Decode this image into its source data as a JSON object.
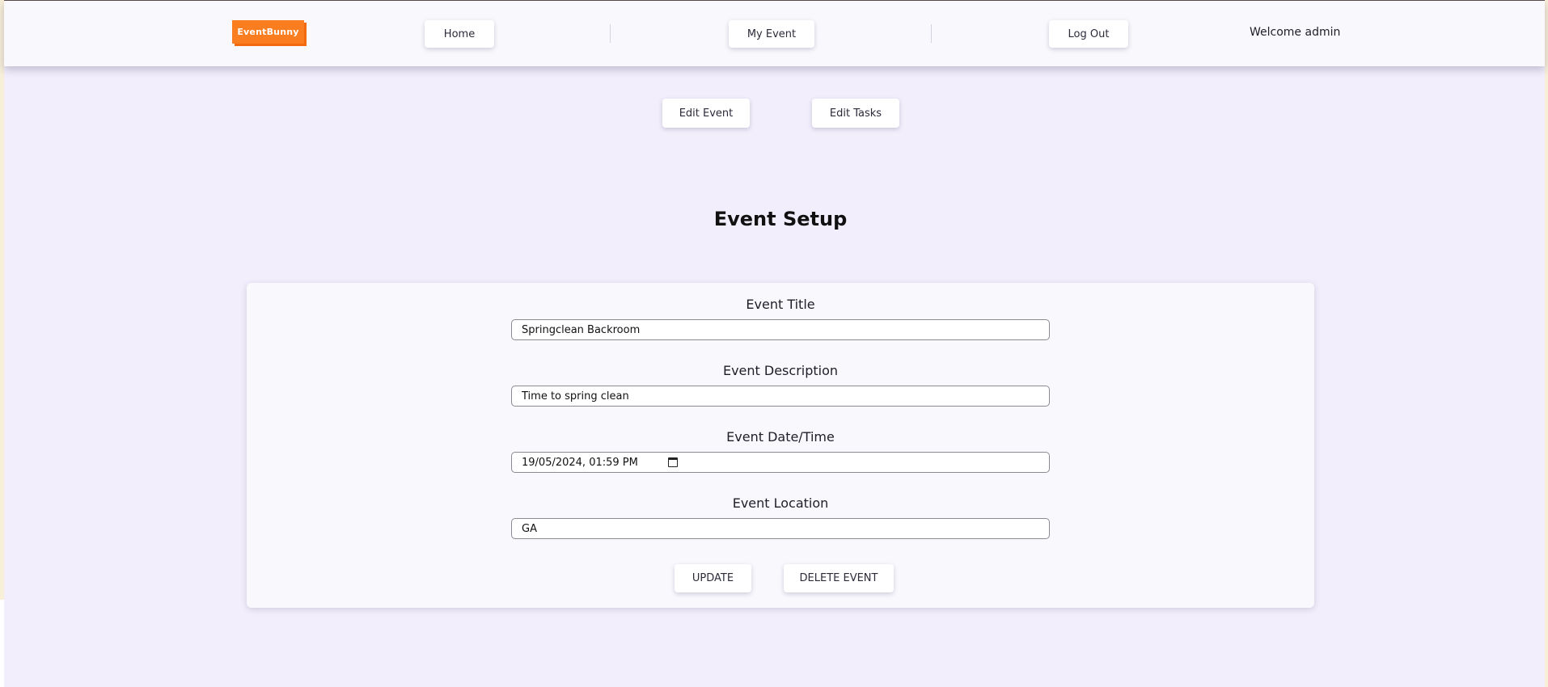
{
  "nav": {
    "logo": "EventBunny",
    "home_label": "Home",
    "my_event_label": "My Event",
    "logout_label": "Log Out",
    "welcome_text": "Welcome admin"
  },
  "subnav": {
    "edit_event_label": "Edit Event",
    "edit_tasks_label": "Edit Tasks"
  },
  "page_title": "Event Setup",
  "form": {
    "title_label": "Event Title",
    "title_value": "Springclean Backroom",
    "description_label": "Event Description",
    "description_value": "Time to spring clean",
    "datetime_label": "Event Date/Time",
    "datetime_value": "19/05/2024, 01:59 PM",
    "datetime_icon": "calendar-icon",
    "location_label": "Event Location",
    "location_value": "GA",
    "update_label": "UPDATE",
    "delete_label": "DELETE EVENT"
  },
  "colors": {
    "brand": "#fa7d1f",
    "page_background": "#f2eefc",
    "card_background": "#f9f8fd"
  }
}
